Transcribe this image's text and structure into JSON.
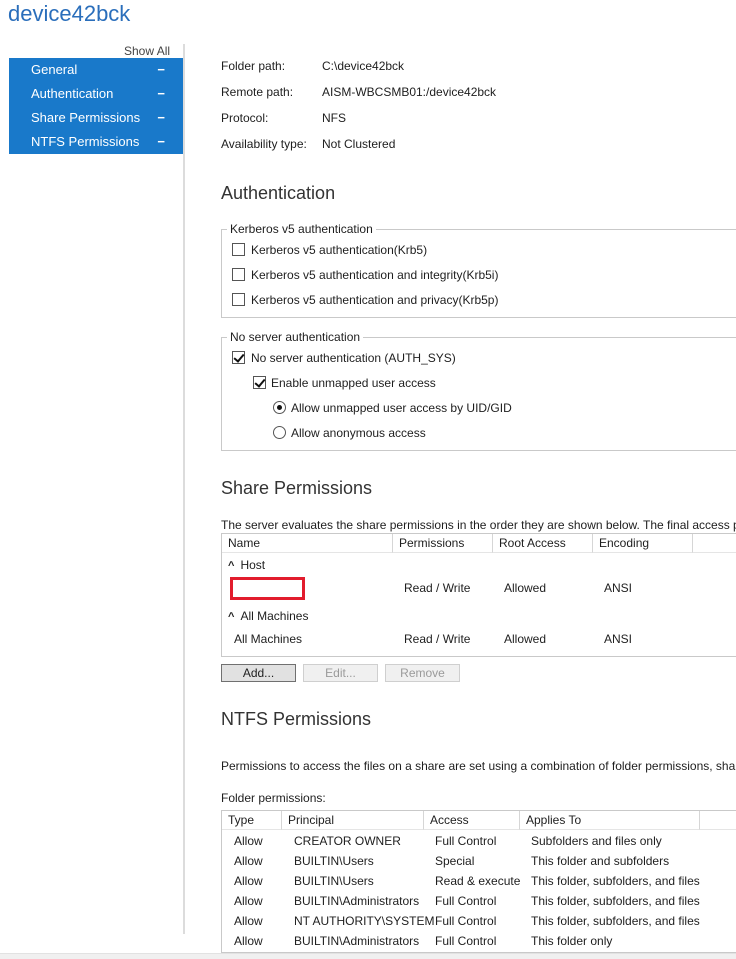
{
  "page": {
    "title": "device42bck"
  },
  "sidebar": {
    "show_all": "Show All",
    "items": [
      {
        "label": "General",
        "toggle": "−"
      },
      {
        "label": "Authentication",
        "toggle": "−"
      },
      {
        "label": "Share Permissions",
        "toggle": "−"
      },
      {
        "label": "NTFS Permissions",
        "toggle": "−"
      }
    ]
  },
  "general": {
    "folder_path_label": "Folder path:",
    "folder_path": "C:\\device42bck",
    "remote_path_label": "Remote path:",
    "remote_path": "AISM-WBCSMB01:/device42bck",
    "protocol_label": "Protocol:",
    "protocol": "NFS",
    "availability_label": "Availability type:",
    "availability": "Not Clustered"
  },
  "authentication": {
    "heading": "Authentication",
    "kerberos": {
      "legend": "Kerberos v5 authentication",
      "options": [
        {
          "label": "Kerberos v5 authentication(Krb5)",
          "checked": false
        },
        {
          "label": "Kerberos v5 authentication and integrity(Krb5i)",
          "checked": false
        },
        {
          "label": "Kerberos v5 authentication and privacy(Krb5p)",
          "checked": false
        }
      ]
    },
    "noserver": {
      "legend": "No server authentication",
      "auth_sys": "No server authentication (AUTH_SYS)",
      "unmapped": "Enable unmapped user access",
      "uid_gid": "Allow unmapped user access by UID/GID",
      "anonymous": "Allow anonymous access"
    }
  },
  "share": {
    "heading": "Share Permissions",
    "description": "The server evaluates the share permissions in the order they are shown below. The final access pe",
    "columns": [
      "Name",
      "Permissions",
      "Root Access",
      "Encoding"
    ],
    "groups": [
      {
        "name": "Host",
        "rows": [
          {
            "name": "",
            "permissions": "Read / Write",
            "root": "Allowed",
            "encoding": "ANSI"
          }
        ]
      },
      {
        "name": "All Machines",
        "rows": [
          {
            "name": "All Machines",
            "permissions": "Read / Write",
            "root": "Allowed",
            "encoding": "ANSI"
          }
        ]
      }
    ],
    "buttons": {
      "add": "Add...",
      "edit": "Edit...",
      "remove": "Remove"
    }
  },
  "ntfs": {
    "heading": "NTFS Permissions",
    "description": "Permissions to access the files on a share are set using a combination of folder permissions, share",
    "folder_label": "Folder permissions:",
    "columns": [
      "Type",
      "Principal",
      "Access",
      "Applies To"
    ],
    "rows": [
      {
        "type": "Allow",
        "principal": "CREATOR OWNER",
        "access": "Full Control",
        "applies": "Subfolders and files only"
      },
      {
        "type": "Allow",
        "principal": "BUILTIN\\Users",
        "access": "Special",
        "applies": "This folder and subfolders"
      },
      {
        "type": "Allow",
        "principal": "BUILTIN\\Users",
        "access": "Read & execute",
        "applies": "This folder, subfolders, and files"
      },
      {
        "type": "Allow",
        "principal": "BUILTIN\\Administrators",
        "access": "Full Control",
        "applies": "This folder, subfolders, and files"
      },
      {
        "type": "Allow",
        "principal": "NT AUTHORITY\\SYSTEM",
        "access": "Full Control",
        "applies": "This folder, subfolders, and files"
      },
      {
        "type": "Allow",
        "principal": "BUILTIN\\Administrators",
        "access": "Full Control",
        "applies": "This folder only"
      }
    ]
  },
  "colors": {
    "accent": "#1979ca",
    "title": "#2a6ebb",
    "highlight": "#e21c2d"
  }
}
